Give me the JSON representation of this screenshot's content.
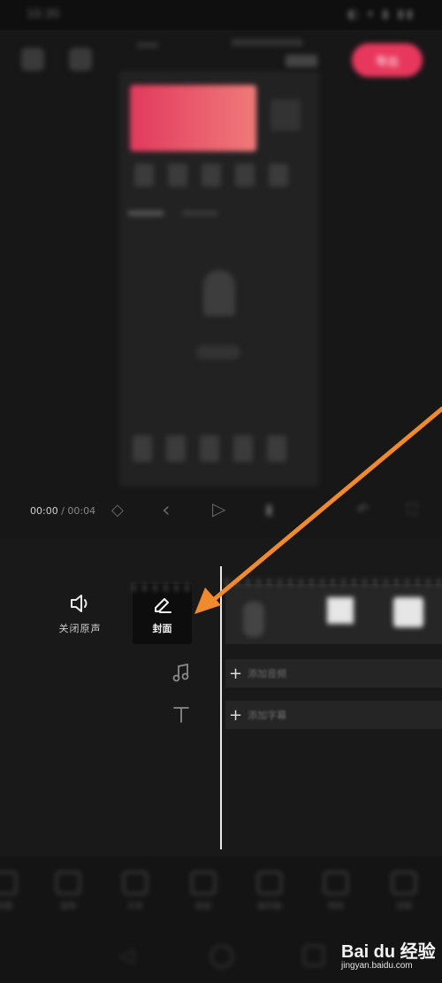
{
  "status_bar": {
    "time": "10:30",
    "indicators": "◧ ▾ ▮ ▮▮"
  },
  "topbar": {
    "export_label": "导出"
  },
  "player": {
    "current_time": "00:00",
    "separator": " / ",
    "total_time": "00:04"
  },
  "timeline": {
    "mute_label": "关闭原声",
    "cover_label": "封面",
    "add_audio_label": "添加音频",
    "add_text_label": "添加字幕"
  },
  "bottom_tools": [
    "剪辑",
    "音频",
    "文本",
    "贴纸",
    "画中画",
    "特效",
    "滤镜"
  ],
  "colors": {
    "accent": "#e8375c",
    "arrow": "#f08a2c",
    "playhead": "#e9e9e9"
  },
  "icons": {
    "mute": "speaker-icon",
    "cover": "pencil-icon",
    "audio": "music-note-icon",
    "text": "text-t-icon"
  },
  "watermark": {
    "main": "Bai du 经验",
    "sub": "jingyan.baidu.com"
  }
}
